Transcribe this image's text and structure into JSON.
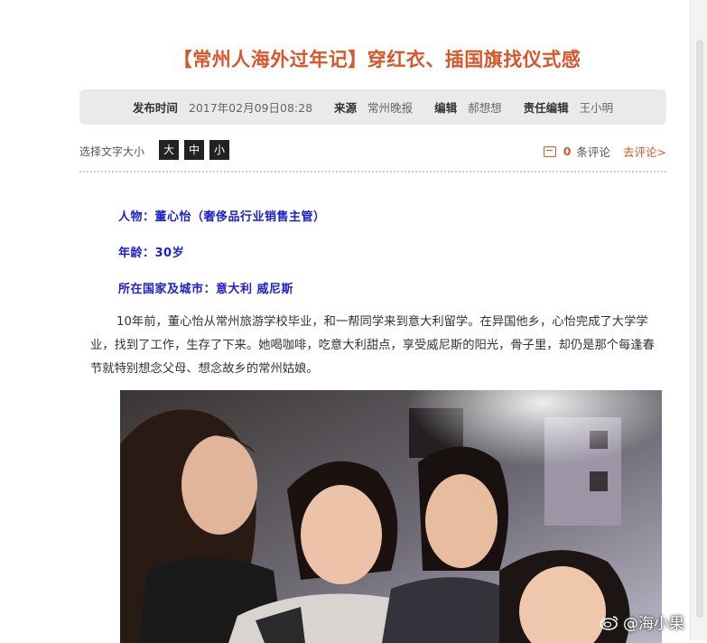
{
  "article": {
    "title": "【常州人海外过年记】穿红衣、插国旗找仪式感",
    "meta": {
      "time_label": "发布时间",
      "time_value": "2017年02月09日08:28",
      "source_label": "来源",
      "source_value": "常州晚报",
      "editor_label": "编辑",
      "editor_value": "郝想想",
      "chief_label": "责任编辑",
      "chief_value": "王小明"
    },
    "font_size": {
      "label": "选择文字大小",
      "large": "大",
      "medium": "中",
      "small": "小"
    },
    "comments": {
      "count": "0",
      "suffix": "条评论",
      "link": "去评论>"
    },
    "profile": {
      "person": "人物：董心怡（奢侈品行业销售主管）",
      "age": "年龄：30岁",
      "location": "所在国家及城市：意大利 威尼斯"
    },
    "body": "10年前，董心怡从常州旅游学校毕业，和一帮同学来到意大利留学。在异国他乡，心怡完成了大学学业，找到了工作，生存了下来。她喝咖啡，吃意大利甜点，享受威尼斯的阳光，骨子里，却仍是那个每逢春节就特别想念父母、想念故乡的常州姑娘。",
    "watermark": "@海小果"
  },
  "colors": {
    "title": "#d9552a",
    "profile": "#1b1fd0",
    "meta_bg": "#eaeaea"
  },
  "icons": [
    "comment-icon",
    "weibo-icon"
  ]
}
